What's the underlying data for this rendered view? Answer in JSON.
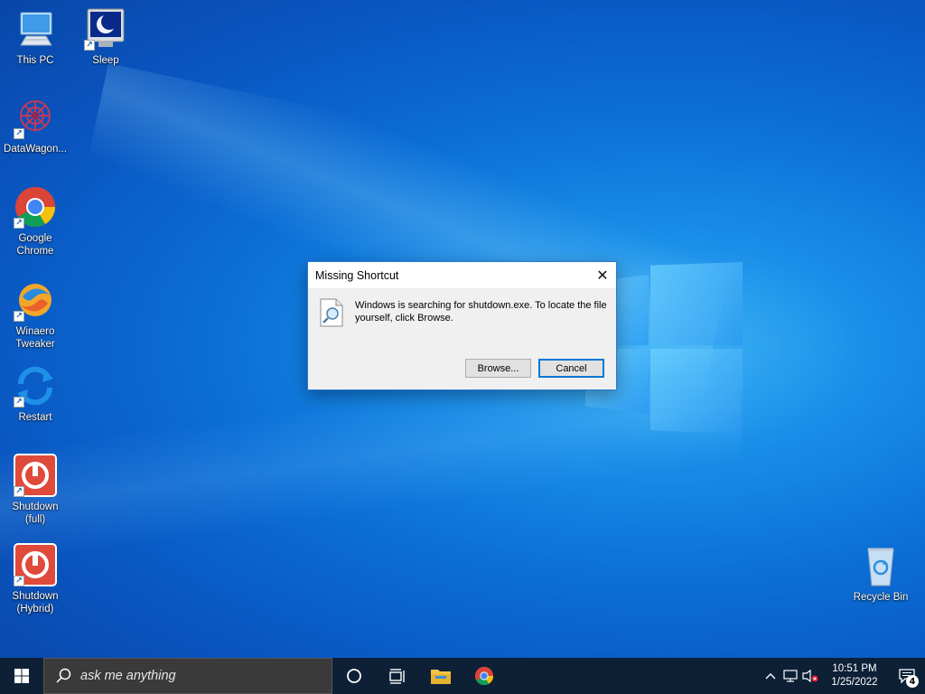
{
  "desktop": {
    "icons": [
      {
        "label": "This PC",
        "icon": "computer-icon"
      },
      {
        "label": "Sleep",
        "icon": "sleep-moon-icon"
      },
      {
        "label": "DataWagon...",
        "icon": "datawagon-icon"
      },
      {
        "label": "Google Chrome",
        "icon": "chrome-icon"
      },
      {
        "label": "Winaero Tweaker",
        "icon": "winaero-icon"
      },
      {
        "label": "Restart",
        "icon": "restart-icon"
      },
      {
        "label": "Shutdown (full)",
        "icon": "power-icon"
      },
      {
        "label": "Shutdown (Hybrid)",
        "icon": "power-icon"
      },
      {
        "label": "Recycle Bin",
        "icon": "recycle-bin-icon"
      }
    ]
  },
  "dialog": {
    "title": "Missing Shortcut",
    "close_label": "✕",
    "message": "Windows is searching for shutdown.exe. To locate the file yourself, click Browse.",
    "browse_label": "Browse...",
    "cancel_label": "Cancel"
  },
  "taskbar": {
    "search_placeholder": "ask me anything",
    "time": "10:51 PM",
    "date": "1/25/2022",
    "notification_count": "4"
  },
  "colors": {
    "taskbar": "#0d2036",
    "accent": "#0078d7",
    "desktop": "#0b6fd6"
  }
}
